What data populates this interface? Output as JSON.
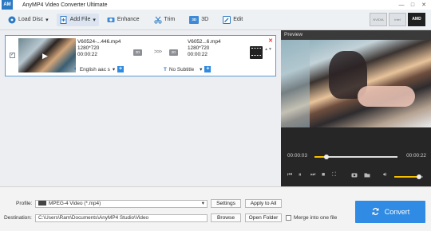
{
  "app": {
    "logo_text": "AnyMP4",
    "logo_glyph": "AM",
    "title": "AnyMP4 Video Converter Ultimate",
    "window_controls": [
      "—",
      "□",
      "✕"
    ]
  },
  "toolbar": {
    "load_disc": "Load Disc",
    "add_file": "Add File",
    "enhance": "Enhance",
    "trim": "Trim",
    "three_d": "3D",
    "edit": "Edit",
    "dropdown_glyph": "▾",
    "gpu": [
      "NVIDIA",
      "Intel",
      "AMD"
    ]
  },
  "file_item": {
    "checked_glyph": "✓",
    "source": {
      "name": "V60524-...446.mp4",
      "resolution": "1280*720",
      "duration": "00:00:22"
    },
    "target": {
      "name": "V6052...6.mp4",
      "resolution": "1280*720",
      "duration": "00:00:22"
    },
    "badge_2d": "2D",
    "arrows": ">>>",
    "audio": "English aac s",
    "subtitle": "No Subtitle",
    "close": "✕",
    "updown": "▲▼"
  },
  "preview": {
    "header": "Preview",
    "time_current": "00:00:03",
    "time_total": "00:00:22",
    "progress_fraction": 0.14,
    "volume_fraction": 0.85
  },
  "bottom": {
    "profile_label": "Profile:",
    "profile_value": "MPEG-4 Video (*.mp4)",
    "settings": "Settings",
    "apply_to_all": "Apply to All",
    "destination_label": "Destination:",
    "destination_value": "C:\\Users\\Ram\\Documents\\AnyMP4 Studio\\Video",
    "browse": "Browse",
    "open_folder": "Open Folder",
    "merge_label": "Merge into one file",
    "convert": "Convert"
  },
  "colors": {
    "accent": "#2f8be3",
    "selection_border": "#5b9bd5",
    "progress": "#f6c000"
  }
}
